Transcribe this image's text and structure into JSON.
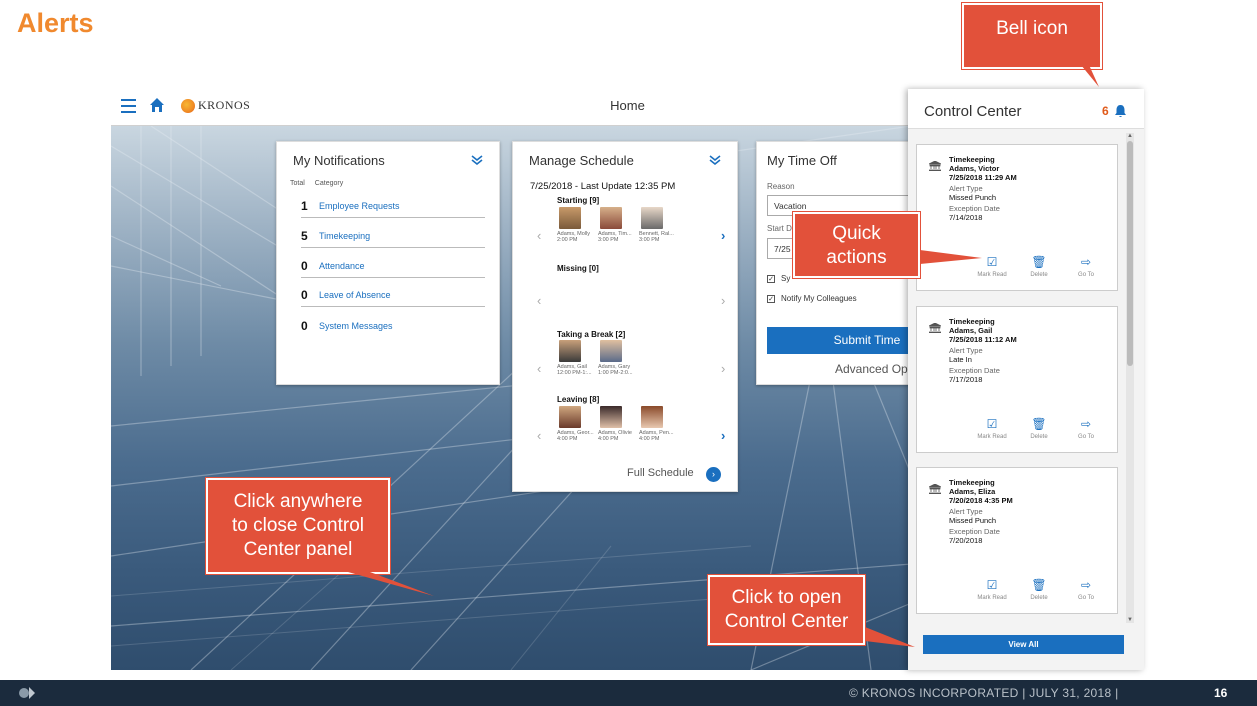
{
  "slide": {
    "title": "Alerts"
  },
  "topbar": {
    "logo": "KRONOS",
    "title": "Home"
  },
  "notifications": {
    "title": "My Notifications",
    "col_total": "Total",
    "col_category": "Category",
    "rows": [
      {
        "count": "1",
        "category": "Employee Requests"
      },
      {
        "count": "5",
        "category": "Timekeeping"
      },
      {
        "count": "0",
        "category": "Attendance"
      },
      {
        "count": "0",
        "category": "Leave of Absence"
      },
      {
        "count": "0",
        "category": "System Messages"
      }
    ]
  },
  "schedule": {
    "title": "Manage Schedule",
    "date": "7/25/2018 - Last Update 12:35 PM",
    "starting": "Starting [9]",
    "missing": "Missing [0]",
    "break": "Taking a Break [2]",
    "leaving": "Leaving [8]",
    "starting_people": [
      {
        "name": "Adams, Molly",
        "time": "2:00 PM"
      },
      {
        "name": "Adams, Tim...",
        "time": "3:00 PM"
      },
      {
        "name": "Bennett, Ral...",
        "time": "3:00 PM"
      }
    ],
    "break_people": [
      {
        "name": "Adams, Gail",
        "time": "12:00 PM-1:..."
      },
      {
        "name": "Adams, Gary",
        "time": "1:00 PM-2:0..."
      }
    ],
    "leaving_people": [
      {
        "name": "Adams, Geor...",
        "time": "4:00 PM"
      },
      {
        "name": "Adams, Olivie",
        "time": "4:00 PM"
      },
      {
        "name": "Adams, Pen...",
        "time": "4:00 PM"
      }
    ],
    "full_schedule": "Full Schedule"
  },
  "timeoff": {
    "title": "My Time Off",
    "reason_label": "Reason",
    "reason_value": "Vacation",
    "start_label": "Start D",
    "start_value": "7/25",
    "check1": "Sy",
    "check2": "Notify My Colleagues",
    "submit": "Submit Time",
    "advanced": "Advanced Op"
  },
  "control_center": {
    "title": "Control Center",
    "count": "6",
    "alert_type_label": "Alert Type",
    "exception_label": "Exception Date",
    "actions": {
      "mark_read": "Mark Read",
      "delete": "Delete",
      "go_to": "Go To"
    },
    "alerts": [
      {
        "category": "Timekeeping",
        "name": "Adams, Victor",
        "datetime": "7/25/2018 11:29 AM",
        "type": "Missed Punch",
        "exception": "7/14/2018"
      },
      {
        "category": "Timekeeping",
        "name": "Adams, Gail",
        "datetime": "7/25/2018 11:12 AM",
        "type": "Late In",
        "exception": "7/17/2018"
      },
      {
        "category": "Timekeeping",
        "name": "Adams, Eliza",
        "datetime": "7/20/2018 4:35 PM",
        "type": "Missed Punch",
        "exception": "7/20/2018"
      }
    ],
    "view_all": "View All"
  },
  "callouts": {
    "bell": "Bell icon",
    "quick_1": "Quick",
    "quick_2": "actions",
    "close_1": "Click anywhere",
    "close_2": "to close Control",
    "close_3": "Center panel",
    "open_1": "Click to open",
    "open_2": "Control Center"
  },
  "footer": {
    "copyright": "© KRONOS INCORPORATED   |   JULY 31, 2018   |",
    "page": "16"
  },
  "colors": {
    "title_orange": "#f0892e",
    "callout_red": "#e2513a",
    "kronos_blue": "#1a6fbf",
    "footer_navy": "#1b2b3d"
  }
}
